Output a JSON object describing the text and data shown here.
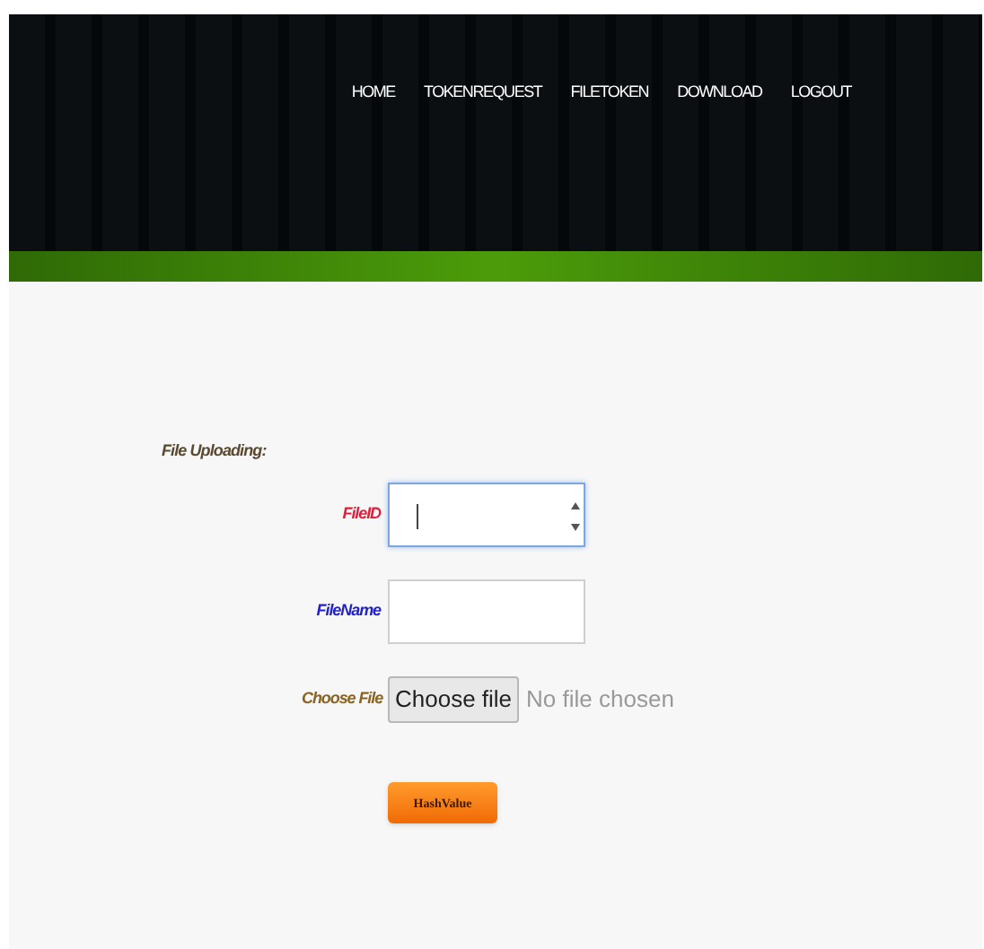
{
  "nav": [
    "HOME",
    "TOKENREQUEST",
    "FILETOKEN",
    "DOWNLOAD",
    "LOGOUT"
  ],
  "form": {
    "title": "File Uploading:",
    "fields": [
      {
        "kind": "number",
        "label": "FileID",
        "color": "#e0203c",
        "focused": true
      },
      {
        "kind": "text",
        "label": "FileName",
        "color": "#2222cc",
        "focused": false
      },
      {
        "kind": "file",
        "label": "Choose File",
        "color": "#8a6420",
        "button": "Choose file",
        "status": "No file chosen"
      }
    ],
    "submit": "HashValue"
  }
}
